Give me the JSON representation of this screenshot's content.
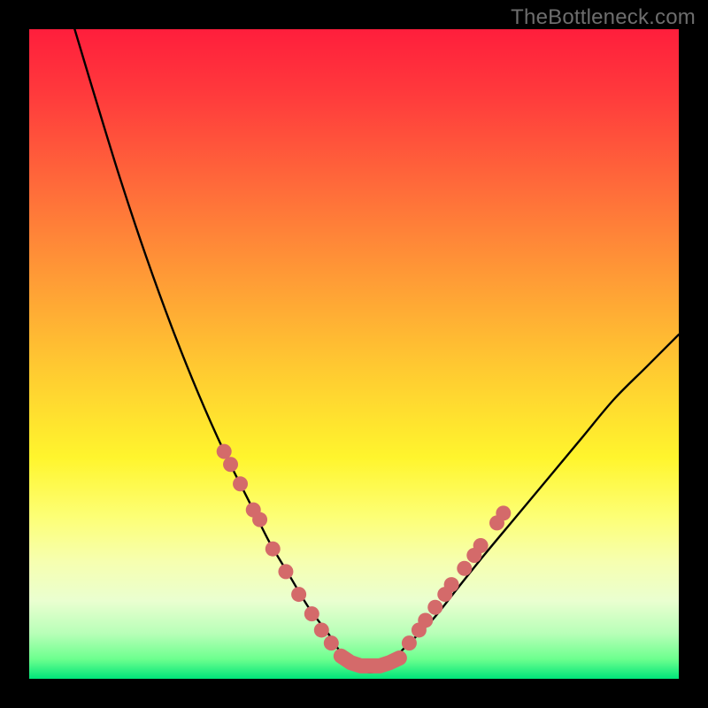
{
  "watermark": "TheBottleneck.com",
  "chart_data": {
    "type": "line",
    "title": "",
    "xlabel": "",
    "ylabel": "",
    "xlim": [
      0,
      100
    ],
    "ylim": [
      0,
      100
    ],
    "series": [
      {
        "name": "curve",
        "x": [
          7,
          10,
          14,
          18,
          22,
          26,
          30,
          34,
          37,
          40,
          43,
          46,
          48,
          50,
          52.5,
          55,
          58,
          62,
          66,
          70,
          75,
          80,
          85,
          90,
          95,
          100
        ],
        "y": [
          100,
          90,
          77,
          65,
          54,
          44,
          35,
          27,
          21,
          16,
          11,
          7,
          4,
          2,
          1,
          2,
          5,
          9,
          14,
          19,
          25,
          31,
          37,
          43,
          48,
          53
        ]
      }
    ],
    "markers": [
      {
        "name": "left-dot-cluster",
        "points": [
          {
            "x": 30,
            "y": 35
          },
          {
            "x": 31,
            "y": 33
          },
          {
            "x": 32.5,
            "y": 30
          },
          {
            "x": 34.5,
            "y": 26
          },
          {
            "x": 35.5,
            "y": 24.5
          },
          {
            "x": 37.5,
            "y": 20
          },
          {
            "x": 39.5,
            "y": 16.5
          },
          {
            "x": 41.5,
            "y": 13
          },
          {
            "x": 43.5,
            "y": 10
          },
          {
            "x": 45,
            "y": 7.5
          },
          {
            "x": 46.5,
            "y": 5.5
          }
        ]
      },
      {
        "name": "bottom-segment",
        "points": [
          {
            "x": 48,
            "y": 3.5
          },
          {
            "x": 49.5,
            "y": 2.5
          },
          {
            "x": 51,
            "y": 2
          },
          {
            "x": 52.5,
            "y": 2
          },
          {
            "x": 54,
            "y": 2
          },
          {
            "x": 55.5,
            "y": 2.5
          },
          {
            "x": 57,
            "y": 3.2
          }
        ]
      },
      {
        "name": "right-dot-cluster",
        "points": [
          {
            "x": 58.5,
            "y": 5.5
          },
          {
            "x": 60,
            "y": 7.5
          },
          {
            "x": 61,
            "y": 9
          },
          {
            "x": 62.5,
            "y": 11
          },
          {
            "x": 64,
            "y": 13
          },
          {
            "x": 65,
            "y": 14.5
          },
          {
            "x": 67,
            "y": 17
          },
          {
            "x": 68.5,
            "y": 19
          },
          {
            "x": 69.5,
            "y": 20.5
          },
          {
            "x": 72,
            "y": 24
          },
          {
            "x": 73,
            "y": 25.5
          }
        ]
      }
    ],
    "colors": {
      "curve": "#000000",
      "marker_fill": "#d46a6a",
      "marker_stroke": "#c05858"
    }
  }
}
